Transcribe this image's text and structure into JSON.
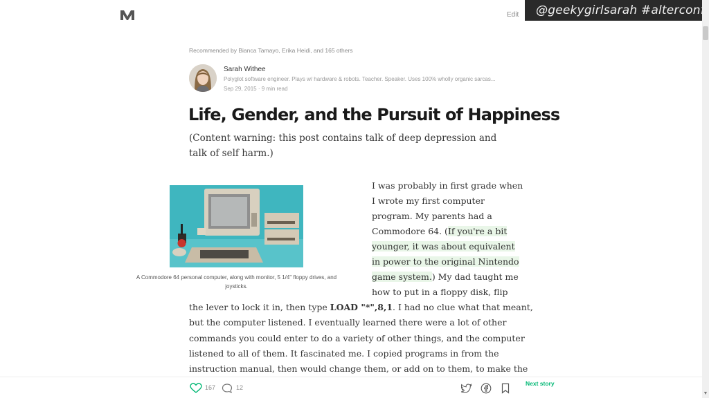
{
  "header": {
    "edit_label": "Edit",
    "watermark": "@geekygirlsarah #alterconf"
  },
  "article": {
    "recommended_by": "Recommended by Bianca Tamayo, Erika Heidi, and 165 others",
    "author": {
      "name": "Sarah Withee",
      "bio": "Polyglot software engineer. Plays w/ hardware & robots. Teacher. Speaker. Uses 100% wholly organic sarcas...",
      "date": "Sep 29, 2015",
      "read_time": "9 min read"
    },
    "title": "Life, Gender, and the Pursuit of Happiness",
    "content_warning": "(Content warning: this post contains talk of deep depression and talk of self harm.)",
    "image_caption": "A Commodore 64 personal computer, along with monitor, 5 1/4\" floppy drives, and joysticks.",
    "para": {
      "l1": "I was probably in first grade when",
      "l2": "I wrote my first computer",
      "l3": "program. My parents had a",
      "l4a": "Commodore 64. (",
      "l4b": "If you're a bit",
      "l5": "younger, it was about equivalent",
      "l6": "in power to the original Nintendo",
      "l7a": "game system.",
      "l7b": ") My dad taught me",
      "l8": "how to put in a floppy disk, flip",
      "l9a": "the lever to lock it in, then type ",
      "l9b": "LOAD \"*\",8,1",
      "l9c": ". I had no clue what that meant,",
      "l10": "but the computer listened. I eventually learned there were a lot of other",
      "l11": "commands you could enter to do a variety of other things, and the computer",
      "l12": "listened to all of them. It fascinated me. I copied programs in from the",
      "l13": "instruction manual, then would change them, or add on to them, to make the"
    }
  },
  "footer": {
    "likes": "167",
    "responses": "12",
    "next_story": "Next story"
  },
  "icons": [
    "medium-logo-icon",
    "heart-icon",
    "comment-icon",
    "twitter-icon",
    "facebook-icon",
    "bookmark-icon"
  ],
  "colors": {
    "accent": "#02b875",
    "highlight": "#e9f6e8",
    "watermark_bg": "#2a2a2a"
  }
}
